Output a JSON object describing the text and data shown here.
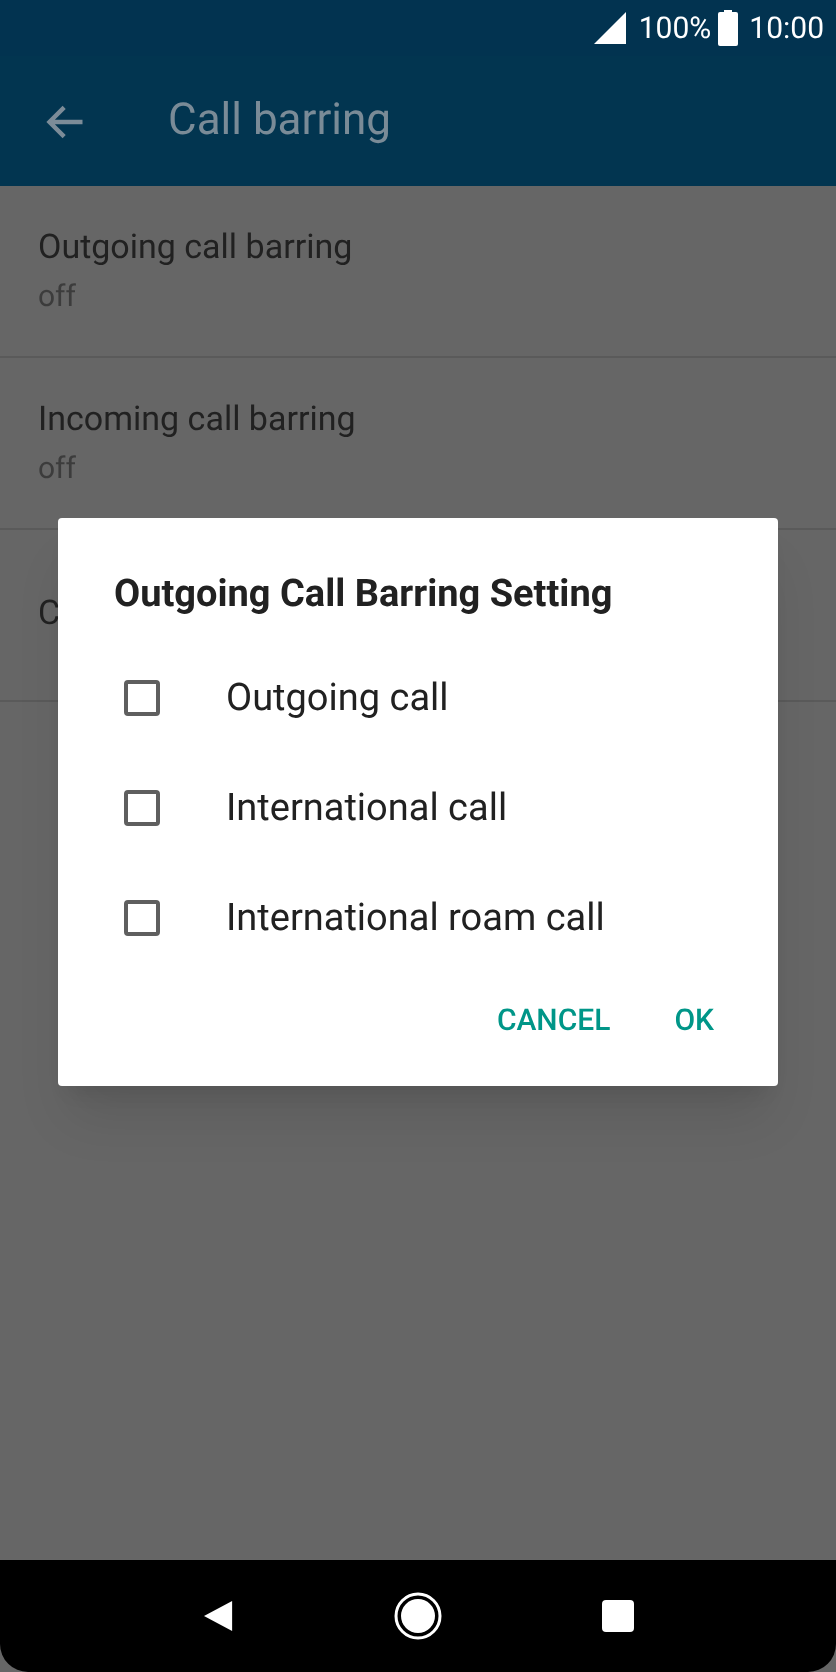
{
  "status_bar": {
    "battery": "100%",
    "time": "10:00"
  },
  "app_bar": {
    "title": "Call barring"
  },
  "list": [
    {
      "title": "Outgoing call barring",
      "subtitle": "off"
    },
    {
      "title": "Incoming call barring",
      "subtitle": "off"
    },
    {
      "title": "C"
    }
  ],
  "dialog": {
    "title": "Outgoing Call Barring Setting",
    "options": [
      {
        "label": "Outgoing call",
        "checked": false
      },
      {
        "label": "International call",
        "checked": false
      },
      {
        "label": "International roam call",
        "checked": false
      }
    ],
    "buttons": [
      "CANCEL",
      "OK"
    ]
  }
}
